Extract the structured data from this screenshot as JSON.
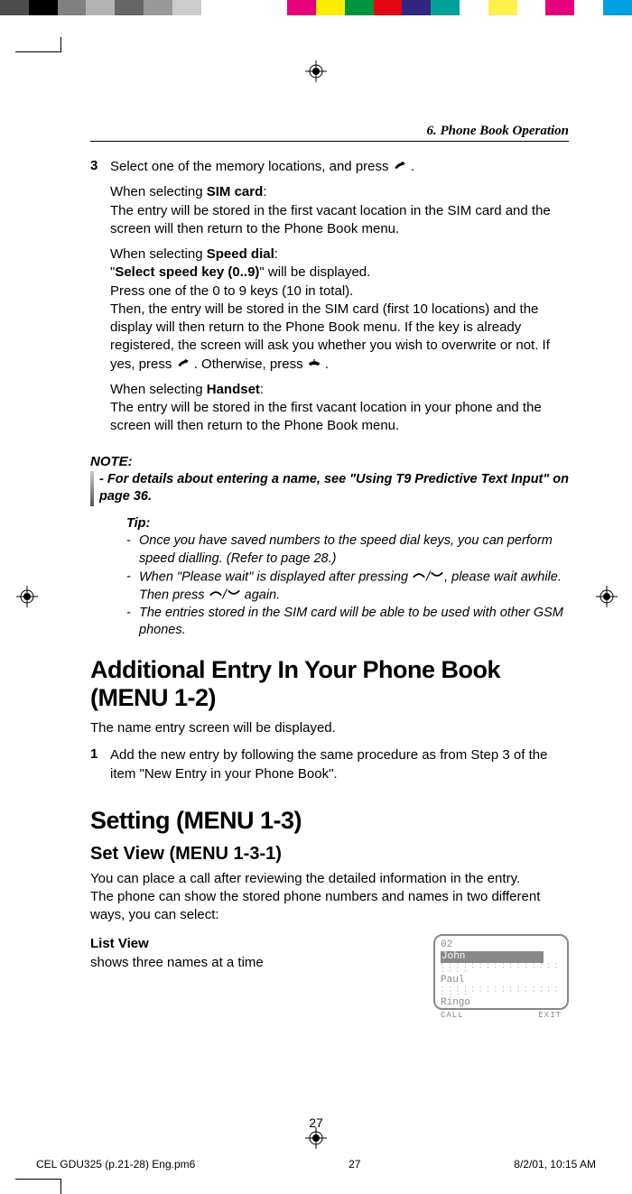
{
  "colorbar": [
    "#4d4d4d",
    "#000000",
    "#808080",
    "#b3b3b3",
    "#666666",
    "#999999",
    "#cccccc",
    "#ffffff",
    "#ffffff",
    "#ffffff",
    "#e6007e",
    "#ffed00",
    "#009640",
    "#e30613",
    "#312783",
    "#00a19a",
    "#ffffff",
    "#fff04c",
    "#ffffff",
    "#e6007e",
    "#ffffff",
    "#009fe3"
  ],
  "header": "6. Phone Book Operation",
  "step3": {
    "num": "3",
    "intro_a": "Select one of the memory locations, and press ",
    "intro_b": ".",
    "sim_label": "SIM card",
    "sim_pre": "When selecting ",
    "sim_post": ":",
    "sim_body": "The entry will be stored in the first vacant location in the SIM card and the screen will then return to the Phone Book menu.",
    "speed_pre": "When selecting ",
    "speed_label": "Speed dial",
    "speed_post": ":",
    "speed_line1_a": "\"",
    "speed_line1_bold": "Select speed key (0..9)",
    "speed_line1_b": "\" will be displayed.",
    "speed_line2": "Press one of the 0 to 9 keys (10 in total).",
    "speed_line3a": "Then, the entry will be stored in the SIM card (first 10 locations) and the display will then return to the Phone Book menu. If the key is already registered, the screen will ask you whether you wish to overwrite or not. If yes, press ",
    "speed_line3b": ". Otherwise, press ",
    "speed_line3c": ".",
    "handset_pre": "When selecting ",
    "handset_label": "Handset",
    "handset_post": ":",
    "handset_body": "The entry will be stored in the first vacant location in your phone and the screen will then return to the Phone Book menu."
  },
  "note": {
    "label": "NOTE:",
    "text": "- For details about entering a name, see \"Using T9 Predictive Text Input\" on page 36."
  },
  "tip": {
    "label": "Tip:",
    "t1": "Once you have saved numbers to the speed dial keys, you can perform speed dialling. (Refer to page 28.)",
    "t2a": "When \"Please wait\" is displayed after pressing ",
    "t2b": ", please wait awhile. Then press ",
    "t2c": " again.",
    "t3": "The entries stored in the SIM card will be able to be used with other GSM phones."
  },
  "h1a": "Additional Entry In Your Phone Book (MENU 1-2)",
  "p1": "The name entry screen will be displayed.",
  "step1": {
    "num": "1",
    "text": "Add the new entry by following the same procedure as from Step 3 of the item \"New Entry in your Phone Book\"."
  },
  "h1b": "Setting (MENU 1-3)",
  "h2a": "Set View (MENU 1-3-1)",
  "p2": "You can place a call after reviewing the detailed information in the entry.",
  "p3": "The phone can show the stored phone numbers and names in two different ways, you can select:",
  "listview": {
    "title": "List View",
    "desc": "shows three names at a time"
  },
  "screen": {
    "row0": "02",
    "row1": "John",
    "row2": "Paul",
    "row3": "Ringo",
    "left": "CALL",
    "right": "EXIT"
  },
  "pagenum": "27",
  "footer": {
    "left": "CEL GDU325 (p.21-28) Eng.pm6",
    "mid": "27",
    "right": "8/2/01, 10:15 AM"
  }
}
